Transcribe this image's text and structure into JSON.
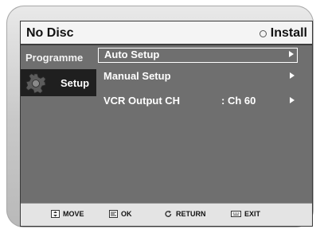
{
  "header": {
    "title": "No Disc",
    "install_label": "Install",
    "install_icon": "ring-icon"
  },
  "sidebar": {
    "items": [
      {
        "label": "Programme",
        "icon": ""
      },
      {
        "label": "Setup",
        "icon": "gear-icon",
        "selected": true
      }
    ]
  },
  "menu": {
    "items": [
      {
        "label": "Auto Setup",
        "value": "",
        "selected": true
      },
      {
        "label": "Manual Setup",
        "value": ""
      },
      {
        "label": "VCR Output CH",
        "value": ": Ch 60"
      }
    ]
  },
  "footer": {
    "move": "MOVE",
    "ok": "OK",
    "return": "RETURN",
    "exit": "EXIT"
  },
  "colors": {
    "screen_bg": "#6f6f6f",
    "header_bg": "#f4f4f4",
    "selected_tab_bg": "#1f1f1f",
    "footer_bg": "#e4e4e4"
  }
}
